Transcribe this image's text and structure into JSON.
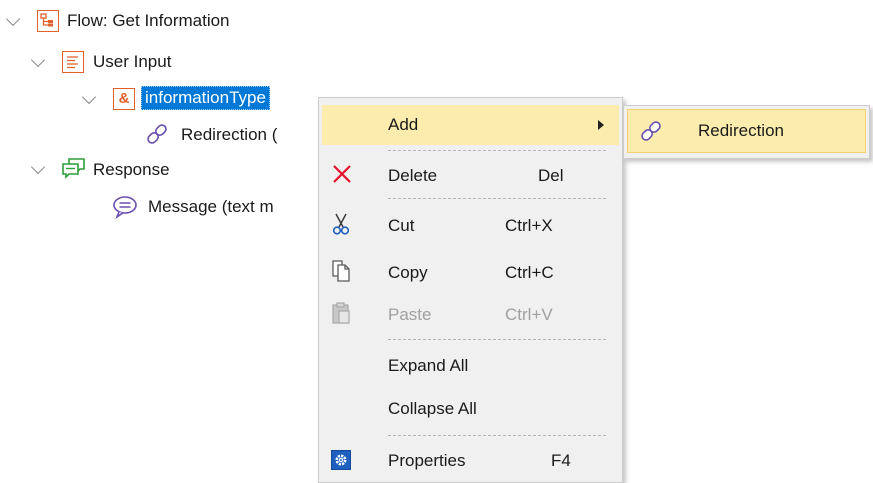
{
  "tree": {
    "flow_label": "Flow: Get Information",
    "user_input_label": "User Input",
    "information_type_label": "informationType",
    "information_type_icon_text": "&",
    "redirection_label": "Redirection (",
    "response_label": "Response",
    "message_label": "Message (text m"
  },
  "context_menu": {
    "add_label": "Add",
    "delete_label": "Delete",
    "delete_shortcut": "Del",
    "cut_label": "Cut",
    "cut_shortcut": "Ctrl+X",
    "copy_label": "Copy",
    "copy_shortcut": "Ctrl+C",
    "paste_label": "Paste",
    "paste_shortcut": "Ctrl+V",
    "expand_all_label": "Expand All",
    "collapse_all_label": "Collapse All",
    "properties_label": "Properties",
    "properties_shortcut": "F4"
  },
  "submenu": {
    "redirection_label": "Redirection"
  },
  "colors": {
    "selection": "#0078d7",
    "menu_highlight": "#fcecae",
    "icon_orange": "#e0612a",
    "response_green": "#2e9e3a",
    "message_purple": "#6a4fb0",
    "delete_red": "#e8112d"
  }
}
